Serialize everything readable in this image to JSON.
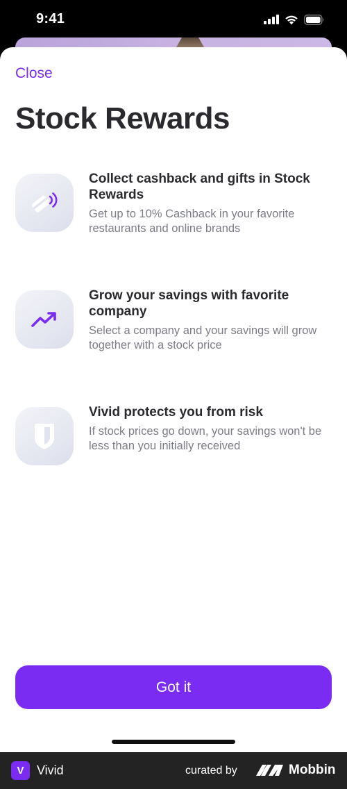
{
  "status_bar": {
    "time": "9:41",
    "icons": [
      "signal-icon",
      "wifi-icon",
      "battery-icon"
    ]
  },
  "sheet": {
    "close_label": "Close",
    "title": "Stock Rewards",
    "features": [
      {
        "icon": "card-contactless-icon",
        "title": "Collect cashback and gifts in Stock Rewards",
        "description": "Get up to 10% Cashback in your favorite restaurants and online brands"
      },
      {
        "icon": "trending-up-icon",
        "title": "Grow your savings with favorite company",
        "description": "Select a company and your savings will grow together with a stock price"
      },
      {
        "icon": "shield-icon",
        "title": "Vivid protects you from risk",
        "description": "If stock prices go down, your savings won't be less than you initially received"
      }
    ],
    "cta_label": "Got it"
  },
  "footer": {
    "app_badge": "V",
    "app_name": "Vivid",
    "curated_by": "curated by",
    "brand": "Mobbin"
  },
  "colors": {
    "accent": "#7a2cf3",
    "title_text": "#2a2a2e",
    "secondary_text": "#7c7c86",
    "icon_tile": "#e4e6ef",
    "footer_bg": "#232323"
  }
}
